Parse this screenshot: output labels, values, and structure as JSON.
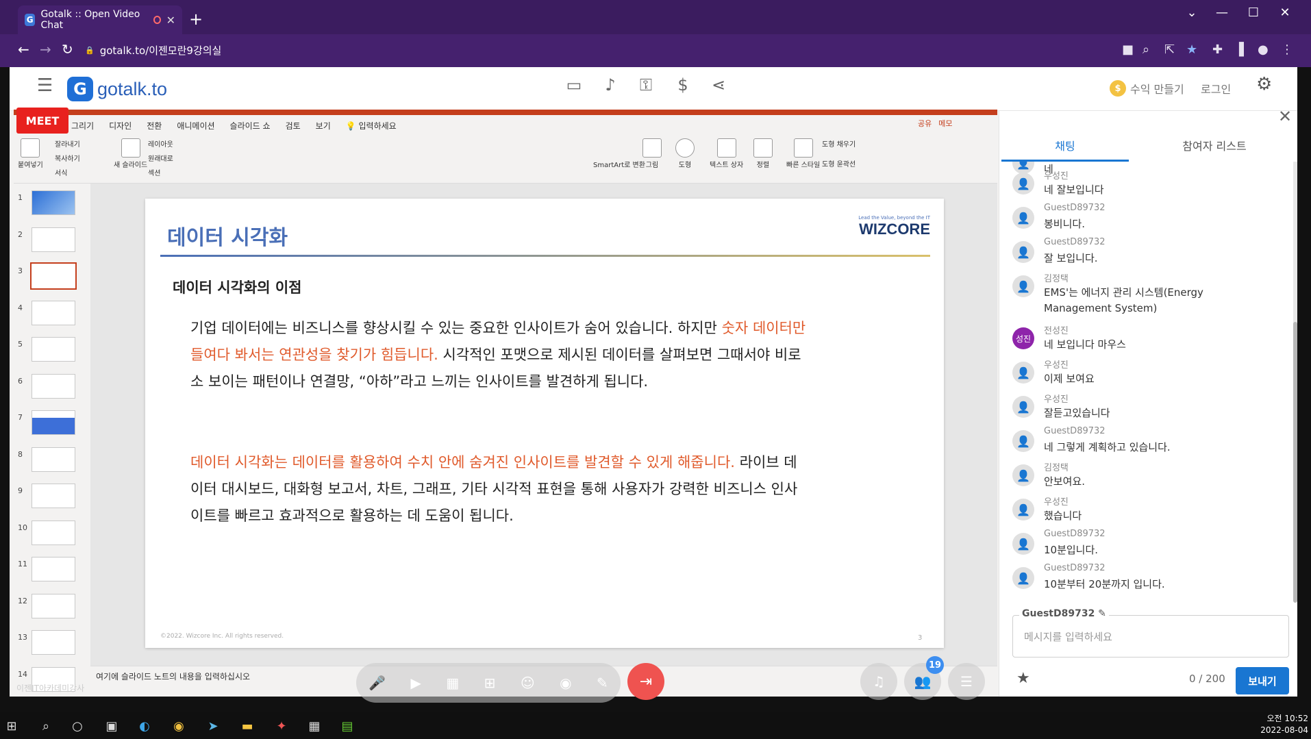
{
  "browser": {
    "tab_title": "Gotalk :: Open Video Chat",
    "favicon_letter": "G",
    "new_tab": "+",
    "url": "gotalk.to/이젠모란9강의실"
  },
  "app": {
    "logo_letter": "G",
    "logo_text": "gotalk.to",
    "earn_label": "수익 만들기",
    "login_label": "로그인",
    "meet_label": "MEET"
  },
  "ribbon": {
    "tabs": [
      "그리기",
      "디자인",
      "전환",
      "애니메이션",
      "슬라이드 쇼",
      "검토",
      "보기",
      "입력하세요"
    ],
    "share": "공유",
    "memo": "메모",
    "groups": [
      "붙여넣기",
      "잘라내기",
      "복사하기",
      "서식",
      "새 슬라이드",
      "레이아웃",
      "원래대로",
      "섹션",
      "SmartArt로 변환",
      "그림",
      "도형",
      "텍스트 상자",
      "정렬",
      "빠른 스타일",
      "도형 채우기",
      "도형 윤곽선"
    ]
  },
  "thumbnails": [
    "1",
    "2",
    "3",
    "4",
    "5",
    "6",
    "7",
    "8",
    "9",
    "10",
    "11",
    "12",
    "13",
    "14"
  ],
  "slide": {
    "title": "데이터 시각화",
    "logo_tagline": "Lead the Value, beyond the IT",
    "logo_name": "WIZCORE",
    "subtitle": "데이터 시각화의 이점",
    "p1_a": "기업 데이터에는 비즈니스를 향상시킬 수 있는 중요한 인사이트가 숨어 있습니다. 하지만 ",
    "p1_red": "숫자 데이터만 들여다 봐서는 연관성을 찾기가 힘듭니다.",
    "p1_b": " 시각적인 포맷으로 제시된 데이터를 살펴보면 그때서야 비로소 보이는 패턴이나 연결망, “아하”라고 느끼는 인사이트를 발견하게 됩니다.",
    "p2_red": "데이터 시각화는 데이터를 활용하여 수치 안에 숨겨진 인사이트를 발견할 수 있게 해줍니다.",
    "p2_b": " 라이브 데이터 대시보드, 대화형 보고서, 차트, 그래프, 기타 시각적 표현을 통해 사용자가 강력한 비즈니스 인사이트를 빠르고 효과적으로 활용하는 데 도움이 됩니다.",
    "footer": "©2022. Wizcore Inc. All rights reserved.",
    "page": "3",
    "notes": "여기에 슬라이드 노트의 내용을 입력하십시오",
    "watermark": "이젠IT아카데미강사"
  },
  "controls": {
    "participants_badge": "19"
  },
  "panel": {
    "tab_chat": "채팅",
    "tab_participants": "참여자 리스트",
    "username": "GuestD89732",
    "input_placeholder": "메시지를 입력하세요",
    "counter": "0 / 200",
    "send": "보내기"
  },
  "messages": [
    {
      "name": "",
      "text": "네",
      "avatar": ""
    },
    {
      "name": "우성진",
      "text": "네 잘보입니다",
      "avatar": ""
    },
    {
      "name": "GuestD89732",
      "text": "봉비니다.",
      "avatar": ""
    },
    {
      "name": "GuestD89732",
      "text": "잘 보입니다.",
      "avatar": ""
    },
    {
      "name": "김정택",
      "text": "EMS'는 에너지 관리 시스템(Energy Management System)",
      "avatar": ""
    },
    {
      "name": "전성진",
      "text": "네 보입니다 마우스",
      "avatar": "성진"
    },
    {
      "name": "우성진",
      "text": "이제 보여요",
      "avatar": ""
    },
    {
      "name": "우성진",
      "text": "잘듣고있습니다",
      "avatar": ""
    },
    {
      "name": "GuestD89732",
      "text": "네 그렇게 계획하고 있습니다.",
      "avatar": ""
    },
    {
      "name": "김정택",
      "text": "안보여요.",
      "avatar": ""
    },
    {
      "name": "우성진",
      "text": "했습니다",
      "avatar": ""
    },
    {
      "name": "GuestD89732",
      "text": "10분입니다.",
      "avatar": ""
    },
    {
      "name": "GuestD89732",
      "text": "10분부터 20분까지 입니다.",
      "avatar": ""
    }
  ],
  "taskbar": {
    "time": "오전 10:52",
    "date": "2022-08-04"
  },
  "colors": {
    "browser_bg": "#3b1c5f",
    "accent": "#1976d2",
    "slide_red": "#e05a2b",
    "slide_title": "#4a6fb7",
    "leave_button": "#ef5350"
  }
}
